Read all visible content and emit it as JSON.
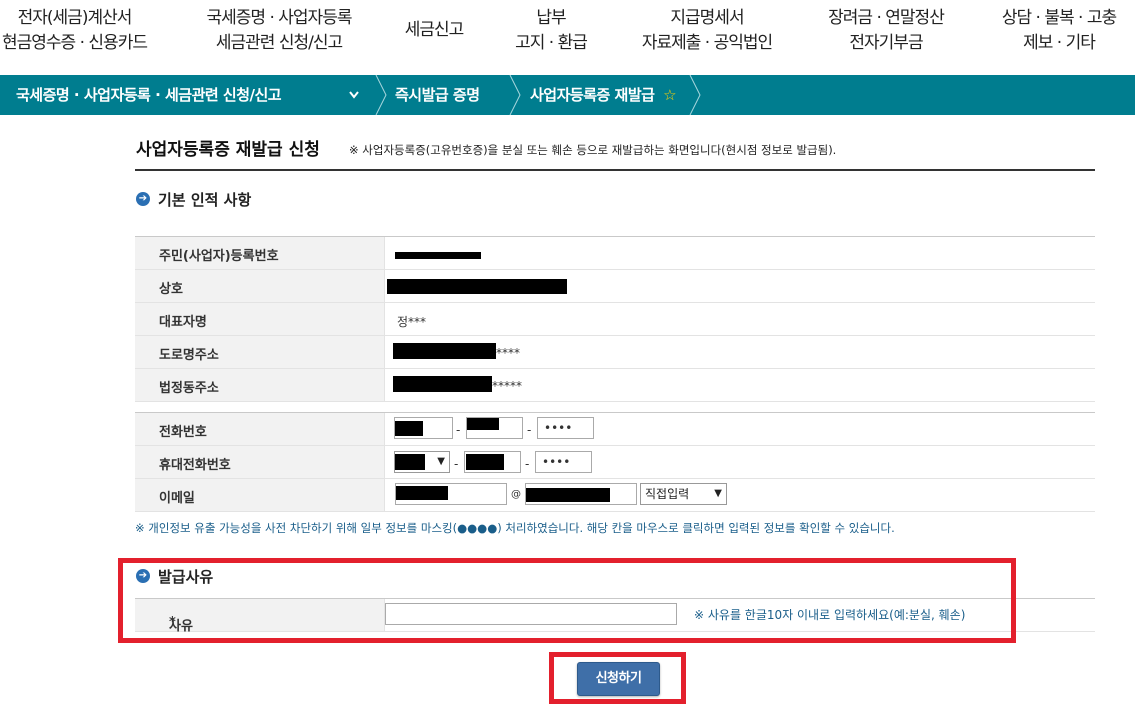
{
  "top_menu": [
    {
      "line1": "전자(세금)계산서",
      "line2": "현금영수증 · 신용카드"
    },
    {
      "line1": "국세증명 · 사업자등록",
      "line2": "세금관련 신청/신고"
    },
    {
      "line1": "세금신고",
      "line2": ""
    },
    {
      "line1": "납부",
      "line2": "고지 · 환급"
    },
    {
      "line1": "지급명세서",
      "line2": "자료제출 · 공익법인"
    },
    {
      "line1": "장려금 · 연말정산",
      "line2": "전자기부금"
    },
    {
      "line1": "상담 · 불복 · 고충",
      "line2": "제보 · 기타"
    }
  ],
  "breadcrumb": {
    "level1": "국세증명 · 사업자등록 · 세금관련 신청/신고",
    "level2": "즉시발급 증명",
    "level3": "사업자등록증 재발급",
    "star": "☆",
    "chevron": "⌄"
  },
  "page": {
    "title": "사업자등록증 재발급 신청",
    "note": "※ 사업자등록증(고유번호증)을 분실 또는 훼손 등으로 재발급하는 화면입니다(현시점 정보로 발급됨)."
  },
  "basic_info": {
    "heading": "기본 인적 사항",
    "rows": [
      {
        "label": "주민(사업자)등록번호",
        "value": ""
      },
      {
        "label": "상호",
        "value": ""
      },
      {
        "label": "대표자명",
        "value": "정***"
      },
      {
        "label": "도로명주소",
        "value": "****"
      },
      {
        "label": "법정동주소",
        "value": "*****"
      }
    ]
  },
  "contact": {
    "phone_label": "전화번호",
    "mobile_label": "휴대전화번호",
    "email_label": "이메일",
    "masked": "••••",
    "dash": "-",
    "at": "@",
    "email_domain_select": "직접입력"
  },
  "notice": "※ 개인정보 유출 가능성을 사전 차단하기 위해 일부 정보를 마스킹(●●●●) 처리하였습니다. 해당 칸을 마우스로 클릭하면 입력된 정보를 확인할 수 있습니다.",
  "reason": {
    "heading": "발급사유",
    "label": "사유",
    "required_mark": "*",
    "value": "",
    "hint": "※ 사유를 한글10자 이내로 입력하세요(예:분실, 훼손)"
  },
  "submit_label": "신청하기",
  "colors": {
    "bar": "#007d8f",
    "highlight": "#e3202d",
    "button": "#3f6fa8"
  }
}
